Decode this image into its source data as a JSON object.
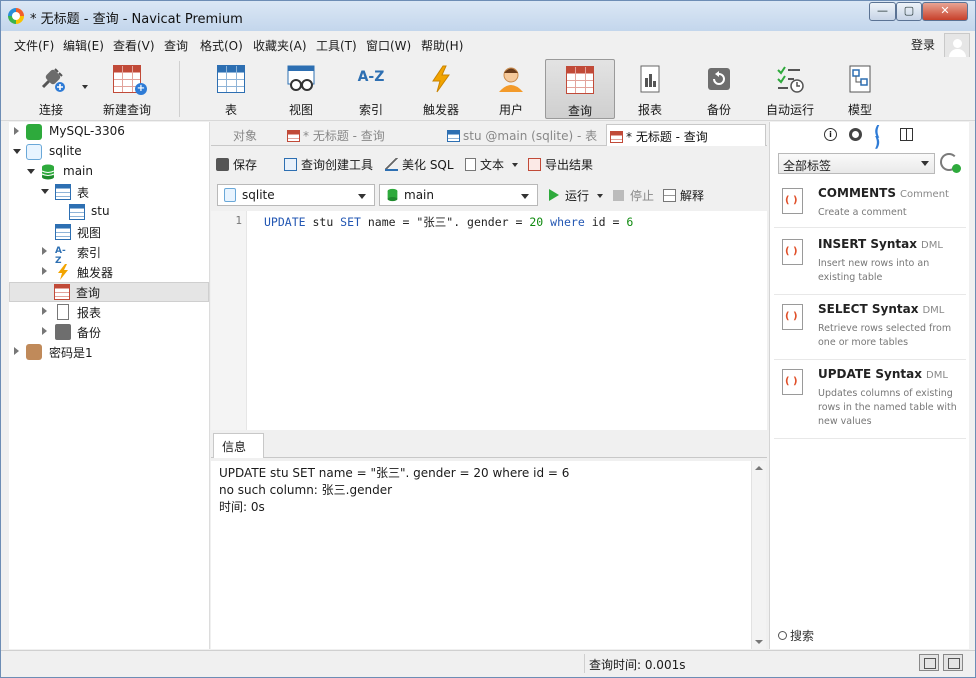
{
  "window": {
    "title": "* 无标题 - 查询 - Navicat Premium",
    "controls": {
      "minimize": "—",
      "maximize": "▢",
      "close": "✕"
    }
  },
  "menu": {
    "items": [
      "文件(F)",
      "编辑(E)",
      "查看(V)",
      "查询",
      "格式(O)",
      "收藏夹(A)",
      "工具(T)",
      "窗口(W)",
      "帮助(H)"
    ],
    "login": "登录"
  },
  "toolbar": {
    "connect": "连接",
    "new_query": "新建查询",
    "table": "表",
    "view": "视图",
    "index": "索引",
    "index_icon_text": "A-Z",
    "trigger": "触发器",
    "user": "用户",
    "query": "查询",
    "report": "报表",
    "backup": "备份",
    "automation": "自动运行",
    "model": "模型"
  },
  "tree": {
    "mysql": "MySQL-3306",
    "sqlite": "sqlite",
    "main": "main",
    "tables": "表",
    "stu": "stu",
    "views": "视图",
    "indexes": "索引",
    "index_icon_text": "A-Z",
    "triggers": "触发器",
    "queries": "查询",
    "reports": "报表",
    "backups": "备份",
    "password_conn": "密码是1"
  },
  "tabs": {
    "objects": "对象",
    "untitled_1": "* 无标题 - 查询",
    "stu_table": "stu @main (sqlite) - 表",
    "untitled_2": "* 无标题 - 查询"
  },
  "query_toolbar": {
    "save": "保存",
    "builder": "查询创建工具",
    "beautify": "美化 SQL",
    "text": "文本",
    "export": "导出结果"
  },
  "query_controls": {
    "connection": "sqlite",
    "database": "main",
    "run": "运行",
    "stop": "停止",
    "explain": "解释"
  },
  "editor": {
    "line_number": "1",
    "sql_parts": [
      "UPDATE",
      " stu ",
      "SET",
      " name = \"张三\". gender = ",
      "20",
      " ",
      "where",
      " id = ",
      "6"
    ]
  },
  "info": {
    "tab": "信息",
    "lines": [
      "UPDATE stu SET name = \"张三\". gender = 20 where id = 6",
      "no such column: 张三.gender",
      "时间: 0s"
    ]
  },
  "right_panel": {
    "tag_filter": "全部标签",
    "snippets": [
      {
        "title": "COMMENTS",
        "tag": "Comment",
        "desc": "Create a comment"
      },
      {
        "title": "INSERT Syntax",
        "tag": "DML",
        "desc": "Insert new rows into an existing table"
      },
      {
        "title": "SELECT Syntax",
        "tag": "DML",
        "desc": "Retrieve rows selected from one or more tables"
      },
      {
        "title": "UPDATE Syntax",
        "tag": "DML",
        "desc": "Updates columns of existing rows in the named table with new values"
      }
    ],
    "search": "搜索"
  },
  "status": {
    "query_time": "查询时间: 0.001s"
  },
  "colors": {
    "keyword": "#2357b3",
    "number": "#0f8a0f",
    "accent": "#2d6fb2"
  }
}
